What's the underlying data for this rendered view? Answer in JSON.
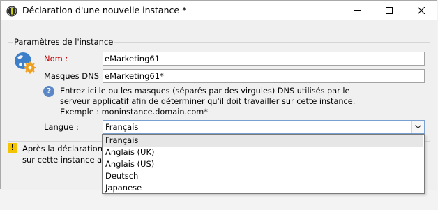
{
  "window": {
    "title": "Déclaration d'une nouvelle instance *",
    "icon": "app-logo-icon",
    "controls": [
      "minimize-icon",
      "maximize-icon",
      "close-icon"
    ]
  },
  "section": {
    "legend": "Paramètres de l'instance",
    "icon": "globe-gear-icon"
  },
  "form": {
    "nom_label": "Nom :",
    "nom_value": "eMarketing61",
    "masques_label": "Masques DNS :",
    "masques_value": "eMarketing61*",
    "help_lines": [
      "Entrez ici le ou les masques (séparés par des virgules) DNS utilisés par le",
      "serveur applicatif afin de déterminer qu'il doit travailler sur cette instance.",
      "Exemple : moninstance.domain.com*"
    ],
    "langue_label": "Langue :",
    "langue_value": "Français"
  },
  "warning": {
    "lines": [
      "Après la déclaration d",
      "sur cette instance afin"
    ]
  },
  "dropdown": {
    "options": [
      "Français",
      "Anglais (UK)",
      "Anglais (US)",
      "Deutsch",
      "Japanese"
    ],
    "selected": "Français"
  },
  "colors": {
    "required_label": "#c00000",
    "help_icon": "#5b87c7",
    "warning_icon": "#f5c400",
    "combo_border": "#7a9fd1"
  }
}
